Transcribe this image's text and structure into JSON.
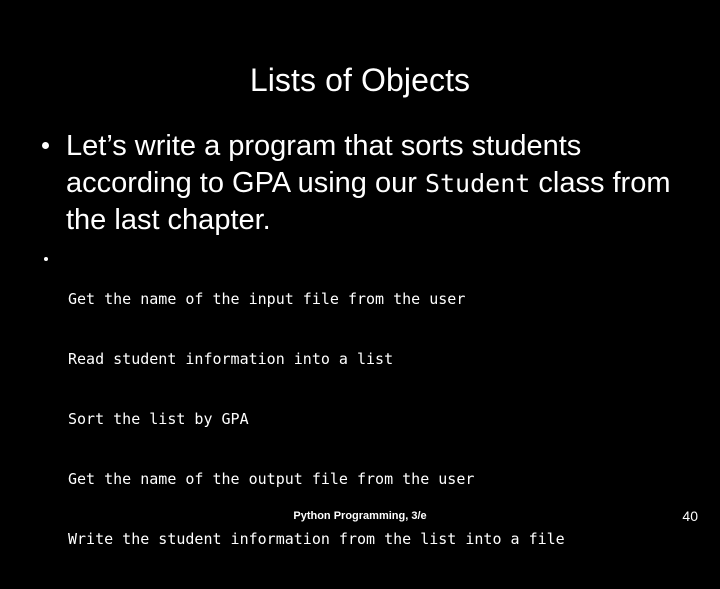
{
  "slide": {
    "background_color": "#000000",
    "text_color": "#ffffff",
    "title": "Lists of Objects",
    "page_number": "40",
    "footer": "Python Programming, 3/e"
  },
  "body": {
    "bullet_level1": {
      "marker": "round-dot",
      "segments": {
        "part1": "Let’s write a program that sorts students according to GPA using our ",
        "code_term": "Student",
        "part2": " class from the last chapter."
      },
      "rendered_lines": [
        "Let’s write a program that sorts students",
        "according to GPA using our Student class",
        "from the last chapter."
      ]
    },
    "bullet_level2": {
      "marker": "small-dot",
      "code_lines": [
        "Get the name of the input file from the user",
        "Read student information into a list",
        "Sort the list by GPA",
        "Get the name of the output file from the user",
        "Write the student information from the list into a file"
      ]
    }
  }
}
